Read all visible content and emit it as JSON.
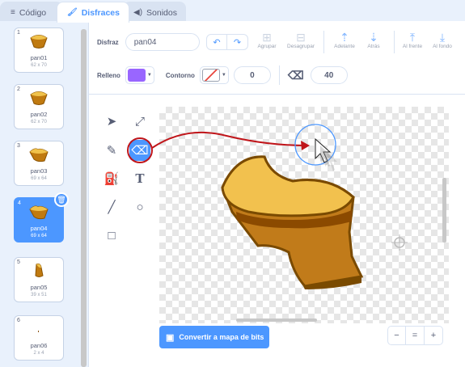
{
  "tabs": [
    {
      "label": "Código",
      "icon": "code-icon"
    },
    {
      "label": "Disfraces",
      "icon": "brush-icon"
    },
    {
      "label": "Sonidos",
      "icon": "speaker-icon"
    }
  ],
  "costumes": [
    {
      "num": "1",
      "name": "pan01",
      "dim": "62 x 70"
    },
    {
      "num": "2",
      "name": "pan02",
      "dim": "62 x 70"
    },
    {
      "num": "3",
      "name": "pan03",
      "dim": "69 x 64"
    },
    {
      "num": "4",
      "name": "pan04",
      "dim": "69 x 64"
    },
    {
      "num": "5",
      "name": "pan05",
      "dim": "39 x 51"
    },
    {
      "num": "6",
      "name": "pan06",
      "dim": "2 x 4"
    }
  ],
  "toolbar": {
    "costume_label": "Disfraz",
    "costume_name": "pan04",
    "group": "Agrupar",
    "ungroup": "Desagrupar",
    "forward": "Adelante",
    "backward": "Atrás",
    "front": "Al frente",
    "back": "Al fondo",
    "fill_label": "Relleno",
    "outline_label": "Contorno",
    "outline_width": "0",
    "eraser_size": "40"
  },
  "colors": {
    "fill": "#9966ff",
    "accent": "#4c97ff",
    "annotation": "#c0151a"
  },
  "convert_button": "Convertir a mapa de bits",
  "zoom": {
    "out": "−",
    "reset": "=",
    "in": "+"
  }
}
